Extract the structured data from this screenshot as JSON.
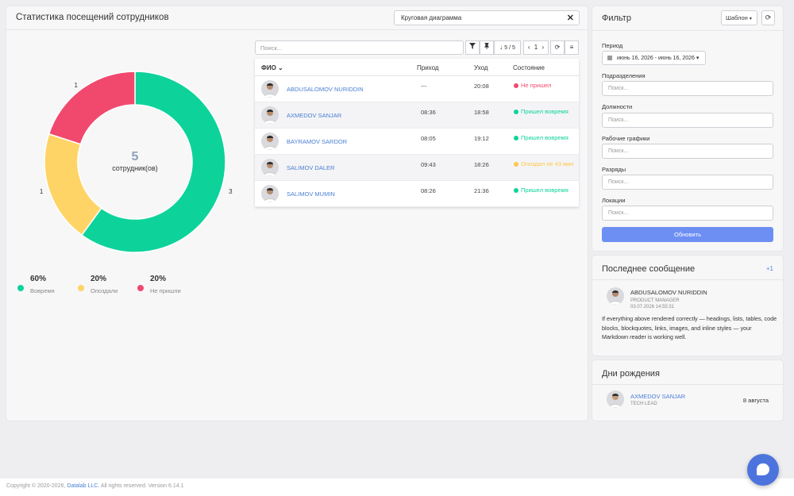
{
  "header": {
    "title": "Статистика посещений сотрудников",
    "chart_type_select": "Круговая диаграмма",
    "clear_symbol": "✕"
  },
  "donut": {
    "center_count": "5",
    "center_label": "сотрудник(ов)",
    "segments": [
      {
        "label": "3",
        "value": 3,
        "color": "#0dd39b"
      },
      {
        "label": "1",
        "value": 1,
        "color": "#ffd466"
      },
      {
        "label": "1",
        "value": 1,
        "color": "#f1496e"
      }
    ]
  },
  "legend": [
    {
      "pct": "60%",
      "label": "Вовремя",
      "color": "#0dd39b"
    },
    {
      "pct": "20%",
      "label": "Опоздали",
      "color": "#ffd466"
    },
    {
      "pct": "20%",
      "label": "Не пришли",
      "color": "#f1496e"
    }
  ],
  "toolbar": {
    "search_placeholder": "Поиск...",
    "filter_icon": "funnel-icon",
    "pin_icon": "pin-icon",
    "sort_label": "5 / 5",
    "page_label": "1",
    "prev": "‹",
    "next": "›"
  },
  "table": {
    "headers": {
      "name": "ФИО",
      "in": "Приход",
      "out": "Уход",
      "state": "Состояние"
    },
    "rows": [
      {
        "name": "ABDUSALOMOV NURIDDIN",
        "in": "---",
        "out": "20:08",
        "state": "Не пришел",
        "color": "#f1496e"
      },
      {
        "name": "AXMEDOV SANJAR",
        "in": "08:36",
        "out": "18:58",
        "state": "Пришел вовремя",
        "color": "#0dd39b"
      },
      {
        "name": "BAYRAMOV SARDOR",
        "in": "08:05",
        "out": "19:12",
        "state": "Пришел вовремя",
        "color": "#0dd39b"
      },
      {
        "name": "SALIMOV DALER",
        "in": "09:43",
        "out": "18:26",
        "state": "Опоздал не 43 мин",
        "color": "#ffc84a"
      },
      {
        "name": "SALIMOV MUMIN",
        "in": "08:26",
        "out": "21:36",
        "state": "Пришел вовремя",
        "color": "#0dd39b"
      }
    ]
  },
  "filter": {
    "title": "Фильтр",
    "template_label": "Шаблон",
    "period_label": "Период",
    "period_value": "июнь 16, 2026 - июнь 16, 2026",
    "fields": [
      {
        "label": "Подразделения",
        "placeholder": "Поиск..."
      },
      {
        "label": "Должности",
        "placeholder": "Поиск..."
      },
      {
        "label": "Рабочие графики",
        "placeholder": "Поиск..."
      },
      {
        "label": "Разряды",
        "placeholder": "Поиск..."
      },
      {
        "label": "Локации",
        "placeholder": "Поиск..."
      }
    ],
    "update_label": "Обновить"
  },
  "last_message": {
    "title": "Последнее сообщение",
    "more": "+1",
    "author": "ABDUSALOMOV NURIDDIN",
    "position": "PRODUCT MANAGER",
    "date": "03.07.2026 14:55:31",
    "text": "If everything above rendered correctly — headings, lists, tables, code blocks, blockquotes, links, images, and inline styles — your Markdown reader is working well."
  },
  "birthdays": {
    "title": "Дни рождения",
    "name": "AXMEDOV SANJAR",
    "position": "TECH LEAD",
    "date": "8 августа"
  },
  "footer": {
    "copyright": "Copyright © 2020-2026,",
    "company": "Datalab LLC.",
    "rights": "All rights reserved. Version 6.14.1"
  }
}
